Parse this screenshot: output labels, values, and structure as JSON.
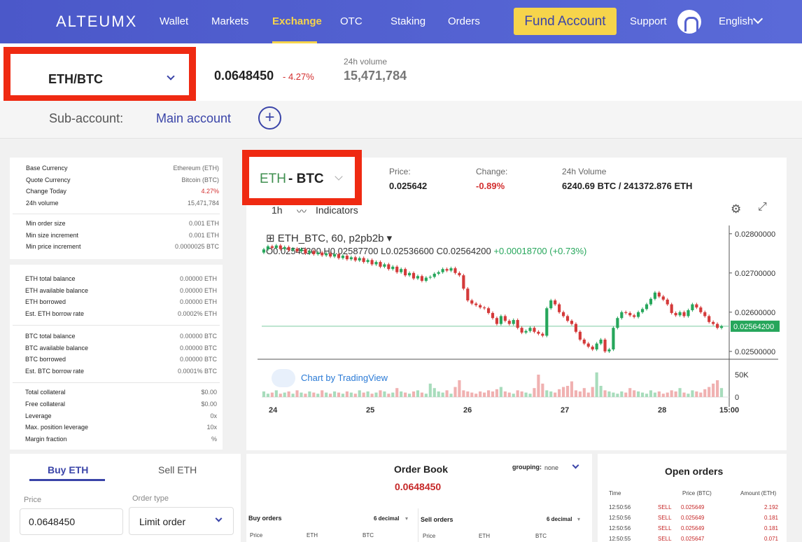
{
  "nav": {
    "logo": "ALTEUMX",
    "items": [
      "Wallet",
      "Markets",
      "Exchange",
      "OTC",
      "Staking",
      "Orders"
    ],
    "fund_label": "Fund Account",
    "support": "Support",
    "language": "English"
  },
  "ticker": {
    "pair": "ETH/BTC",
    "last_price": "0.0648450",
    "change": "- 4.27%",
    "volume_label": "24h volume",
    "volume_value": "15,471,784"
  },
  "subaccount": {
    "label": "Sub-account:",
    "value": "Main account",
    "add_symbol": "+"
  },
  "info": {
    "market": [
      {
        "k": "Base Currency",
        "v": "Ethereum (ETH)"
      },
      {
        "k": "Quote Currency",
        "v": "Bitcoin (BTC)"
      },
      {
        "k": "Change Today",
        "v": "4.27%"
      },
      {
        "k": "24h volume",
        "v": "15,471,784"
      }
    ],
    "limits": [
      {
        "k": "Min order size",
        "v": "0.001 ETH"
      },
      {
        "k": "Min size increment",
        "v": "0.001 ETH"
      },
      {
        "k": "Min price increment",
        "v": "0.0000025 BTC"
      }
    ],
    "eth": [
      {
        "k": "ETH total balance",
        "v": "0.00000 ETH"
      },
      {
        "k": "ETH available balance",
        "v": "0.00000 ETH"
      },
      {
        "k": "ETH borrowed",
        "v": "0.00000 ETH"
      },
      {
        "k": "Est. ETH borrow rate",
        "v": "0.0002% ETH"
      }
    ],
    "btc": [
      {
        "k": "BTC total balance",
        "v": "0.00000 BTC"
      },
      {
        "k": "BTC available balance",
        "v": "0.00000 BTC"
      },
      {
        "k": "BTC borrowed",
        "v": "0.00000 BTC"
      },
      {
        "k": "Est. BTC borrow rate",
        "v": "0.0001% BTC"
      }
    ],
    "collateral": [
      {
        "k": "Total collateral",
        "v": "$0.00"
      },
      {
        "k": "Free collateral",
        "v": "$0.00"
      },
      {
        "k": "Leverage",
        "v": "0x"
      },
      {
        "k": "Max. position leverage",
        "v": "10x"
      },
      {
        "k": "Margin fraction",
        "v": "%"
      }
    ]
  },
  "chart_header": {
    "base": "ETH",
    "quote": "- BTC",
    "price_label": "Price:",
    "price_value": "0.025642",
    "change_label": "Change:",
    "change_value": "-0.89%",
    "vol_label": "24h Volume",
    "vol_value": "6240.69 BTC / 241372.876 ETH"
  },
  "tv": {
    "interval": "1h",
    "indicators": "Indicators",
    "symbol": "ETH_BTC, 60, p2pb2b",
    "ohlc_o": "O0.02545300",
    "ohlc_h": "H0.02587700",
    "ohlc_l": "L0.02536600",
    "ohlc_c": "C0.02564200",
    "ohlc_chg": "+0.00018700 (+0.73%)",
    "branding": "Chart by TradingView",
    "price_ticks": [
      "0.02800000",
      "0.02700000",
      "0.02600000",
      "0.02500000"
    ],
    "last_tag": "0.02564200",
    "vol_tick": "50K",
    "zero_tick": "0",
    "x_ticks": [
      "24",
      "25",
      "26",
      "27",
      "28",
      "15:00"
    ]
  },
  "trade": {
    "buy_tab": "Buy ETH",
    "sell_tab": "Sell ETH",
    "price_label": "Price",
    "price_value": "0.0648450",
    "type_label": "Order type",
    "type_value": "Limit order"
  },
  "orderbook": {
    "title": "Order Book",
    "grouping": "grouping:",
    "grouping_value": "none",
    "price": "0.0648450",
    "buy_label": "Buy orders",
    "sell_label": "Sell orders",
    "decimal": "6 decimal",
    "cols": [
      "Price",
      "ETH",
      "BTC"
    ]
  },
  "open_orders": {
    "title": "Open orders",
    "cols": [
      "Time",
      "Price (BTC)",
      "Amount (ETH)"
    ],
    "rows": [
      {
        "time": "12:50:56",
        "side": "SELL",
        "price": "0.025649",
        "amount": "2.192"
      },
      {
        "time": "12:50:56",
        "side": "SELL",
        "price": "0.025649",
        "amount": "0.181"
      },
      {
        "time": "12:50:56",
        "side": "SELL",
        "price": "0.025649",
        "amount": "0.181"
      },
      {
        "time": "12:50:55",
        "side": "SELL",
        "price": "0.025647",
        "amount": "0.071"
      }
    ]
  },
  "chart_data": {
    "type": "candlestick",
    "symbol": "ETH_BTC",
    "interval": "60",
    "x_ticks": [
      "24",
      "25",
      "26",
      "27",
      "28",
      "15:00"
    ],
    "ylim": [
      0.0248,
      0.0283
    ],
    "close": [
      0.0276,
      0.02768,
      0.02764,
      0.0277,
      0.02761,
      0.02766,
      0.02758,
      0.02762,
      0.02755,
      0.02761,
      0.0275,
      0.02756,
      0.02748,
      0.02752,
      0.02745,
      0.0275,
      0.02742,
      0.02748,
      0.02738,
      0.02744,
      0.02735,
      0.0274,
      0.02732,
      0.02738,
      0.02728,
      0.02733,
      0.02722,
      0.02728,
      0.02716,
      0.02722,
      0.0271,
      0.02716,
      0.02702,
      0.0271,
      0.02694,
      0.027,
      0.02686,
      0.02692,
      0.0268,
      0.02688,
      0.0269,
      0.02698,
      0.02702,
      0.0271,
      0.02706,
      0.02712,
      0.027,
      0.02694,
      0.0266,
      0.0263,
      0.02622,
      0.02618,
      0.02612,
      0.0261,
      0.02598,
      0.02585,
      0.0257,
      0.0259,
      0.02578,
      0.0257,
      0.0258,
      0.0256,
      0.02548,
      0.02552,
      0.0256,
      0.0255,
      0.02545,
      0.0254,
      0.0261,
      0.0263,
      0.0262,
      0.026,
      0.0259,
      0.02578,
      0.0257,
      0.0255,
      0.0253,
      0.0252,
      0.02512,
      0.02505,
      0.0252,
      0.0253,
      0.025,
      0.02505,
      0.0256,
      0.02585,
      0.026,
      0.02598,
      0.02592,
      0.02588,
      0.026,
      0.02608,
      0.0262,
      0.02634,
      0.0265,
      0.0264,
      0.02632,
      0.0262,
      0.02598,
      0.02592,
      0.026,
      0.0259,
      0.02605,
      0.0262,
      0.02612,
      0.026,
      0.0259,
      0.02575,
      0.0257,
      0.0256,
      0.02564
    ],
    "volume_k": [
      5,
      3,
      4,
      6,
      3,
      4,
      5,
      3,
      6,
      4,
      3,
      5,
      4,
      3,
      6,
      4,
      3,
      5,
      4,
      3,
      5,
      4,
      3,
      6,
      4,
      5,
      3,
      4,
      6,
      5,
      3,
      4,
      8,
      5,
      4,
      3,
      5,
      6,
      4,
      3,
      12,
      8,
      5,
      4,
      6,
      3,
      9,
      15,
      6,
      5,
      4,
      3,
      5,
      4,
      6,
      5,
      7,
      9,
      5,
      4,
      3,
      6,
      5,
      4,
      3,
      8,
      20,
      12,
      6,
      5,
      4,
      7,
      9,
      10,
      14,
      6,
      5,
      8,
      4,
      9,
      22,
      10,
      6,
      5,
      4,
      3,
      5,
      4,
      8,
      6,
      5,
      4,
      3,
      6,
      4,
      5,
      3,
      4,
      6,
      5,
      8,
      4,
      3,
      6,
      5,
      4,
      7,
      9,
      12,
      15,
      8
    ]
  }
}
